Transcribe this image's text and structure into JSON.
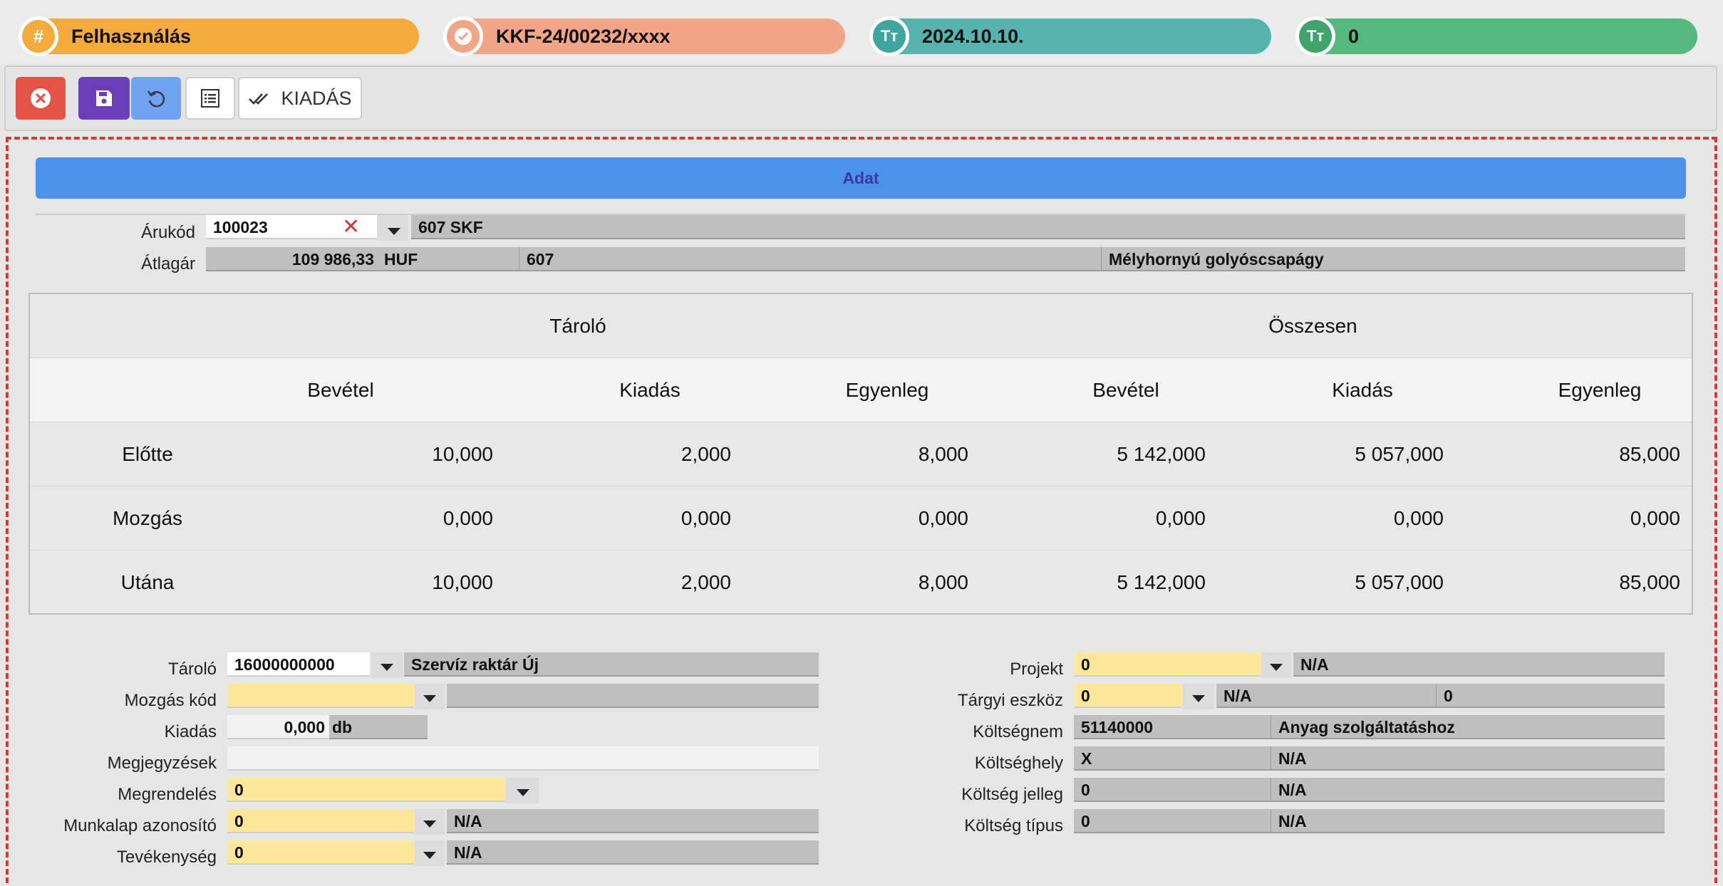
{
  "header": {
    "pills": [
      {
        "icon": "hash-icon",
        "glyph": "#",
        "text": "Felhasználás",
        "color": "#f5ab3c",
        "circle": "#f5ab3c"
      },
      {
        "icon": "check-badge-icon",
        "glyph": "✓",
        "text": "KKF-24/00232/xxxx",
        "color": "#f2a687",
        "circle": "#f2a687"
      },
      {
        "icon": "text-type-icon",
        "glyph": "Tт",
        "text": "2024.10.10.",
        "color": "#57b3ad",
        "circle": "#3fa69f"
      },
      {
        "icon": "text-type-icon",
        "glyph": "Tт",
        "text": "0",
        "color": "#55b87d",
        "circle": "#3fa56a"
      }
    ]
  },
  "toolbar": {
    "close_icon": "close-circle-icon",
    "save_icon": "save-icon",
    "undo_icon": "undo-icon",
    "list_icon": "list-icon",
    "kiadas_label": "KIADÁS"
  },
  "section_title": "Adat",
  "item": {
    "arukod_label": "Árukód",
    "arukod_value": "100023",
    "arukod_name": "607 SKF",
    "atlagar_label": "Átlagár",
    "atlagar_value": "109 986,33",
    "currency": "HUF",
    "code": "607",
    "description": "Mélyhornyú golyóscsapágy"
  },
  "table": {
    "group_headers": [
      "Tároló",
      "Összesen"
    ],
    "columns": [
      "Bevétel",
      "Kiadás",
      "Egyenleg",
      "Bevétel",
      "Kiadás",
      "Egyenleg"
    ],
    "rows": [
      {
        "label": "Előtte",
        "values": [
          "10,000",
          "2,000",
          "8,000",
          "5 142,000",
          "5 057,000",
          "85,000"
        ]
      },
      {
        "label": "Mozgás",
        "values": [
          "0,000",
          "0,000",
          "0,000",
          "0,000",
          "0,000",
          "0,000"
        ]
      },
      {
        "label": "Utána",
        "values": [
          "10,000",
          "2,000",
          "8,000",
          "5 142,000",
          "5 057,000",
          "85,000"
        ]
      }
    ]
  },
  "left_form": {
    "tarolo_label": "Tároló",
    "tarolo_value": "16000000000",
    "tarolo_name": "Szervíz raktár Új",
    "mozgas_label": "Mozgás kód",
    "mozgas_value": "",
    "mozgas_name": "",
    "kiadas_label": "Kiadás",
    "kiadas_value": "0,000",
    "kiadas_unit": "db",
    "megj_label": "Megjegyzések",
    "megj_value": "",
    "megrend_label": "Megrendelés",
    "megrend_value": "0",
    "munkalap_label": "Munkalap azonosító",
    "munkalap_value": "0",
    "munkalap_name": "N/A",
    "tev_label": "Tevékenység",
    "tev_value": "0",
    "tev_name": "N/A"
  },
  "right_form": {
    "projekt_label": "Projekt",
    "projekt_value": "0",
    "projekt_name": "N/A",
    "targyi_label": "Tárgyi eszköz",
    "targyi_value": "0",
    "targyi_name": "N/A",
    "targyi_extra": "0",
    "koltsegnem_label": "Költségnem",
    "koltsegnem_value": "51140000",
    "koltsegnem_name": "Anyag szolgáltatáshoz",
    "koltseghely_label": "Költséghely",
    "koltseghely_value": "X",
    "koltseghely_name": "N/A",
    "jelleg_label": "Költség jelleg",
    "jelleg_value": "0",
    "jelleg_name": "N/A",
    "tipus_label": "Költség típus",
    "tipus_value": "0",
    "tipus_name": "N/A"
  }
}
